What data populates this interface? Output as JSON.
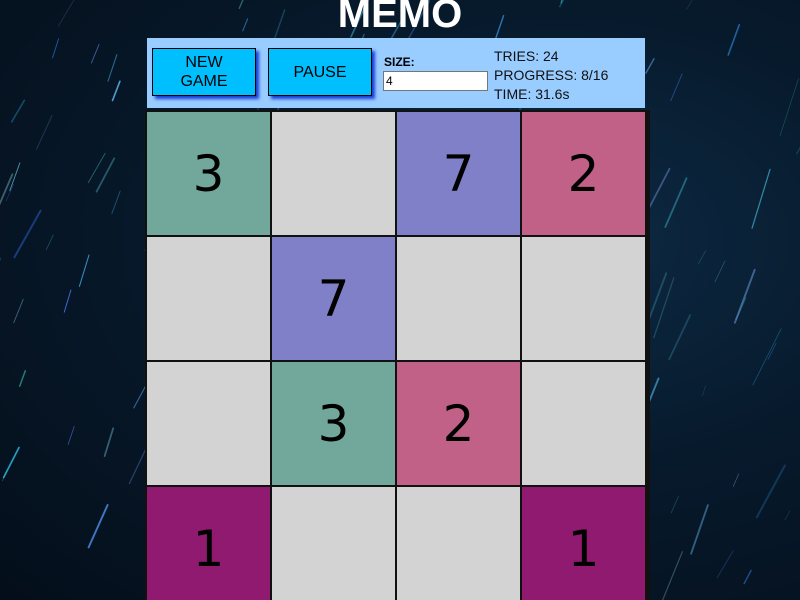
{
  "title": "MEMO",
  "toolbar": {
    "new_game_label": "NEW\nGAME",
    "pause_label": "PAUSE",
    "size_label": "SIZE:",
    "size_value": "4",
    "tries": "TRIES: 24",
    "progress": "PROGRESS: 8/16",
    "time": "TIME: 31.6s"
  },
  "board": {
    "rows": 4,
    "cols": 4,
    "hidden_color": "#d3d3d3",
    "cells": [
      {
        "value": "3",
        "revealed": true,
        "color": "#72a89b"
      },
      {
        "value": "",
        "revealed": false,
        "color": "#d3d3d3"
      },
      {
        "value": "7",
        "revealed": true,
        "color": "#8080c8"
      },
      {
        "value": "2",
        "revealed": true,
        "color": "#c26188"
      },
      {
        "value": "",
        "revealed": false,
        "color": "#d3d3d3"
      },
      {
        "value": "7",
        "revealed": true,
        "color": "#8080c8"
      },
      {
        "value": "",
        "revealed": false,
        "color": "#d3d3d3"
      },
      {
        "value": "",
        "revealed": false,
        "color": "#d3d3d3"
      },
      {
        "value": "",
        "revealed": false,
        "color": "#d3d3d3"
      },
      {
        "value": "3",
        "revealed": true,
        "color": "#72a89b"
      },
      {
        "value": "2",
        "revealed": true,
        "color": "#c26188"
      },
      {
        "value": "",
        "revealed": false,
        "color": "#d3d3d3"
      },
      {
        "value": "1",
        "revealed": true,
        "color": "#8f1a70"
      },
      {
        "value": "",
        "revealed": false,
        "color": "#d3d3d3"
      },
      {
        "value": "",
        "revealed": false,
        "color": "#d3d3d3"
      },
      {
        "value": "1",
        "revealed": true,
        "color": "#8f1a70"
      }
    ]
  }
}
